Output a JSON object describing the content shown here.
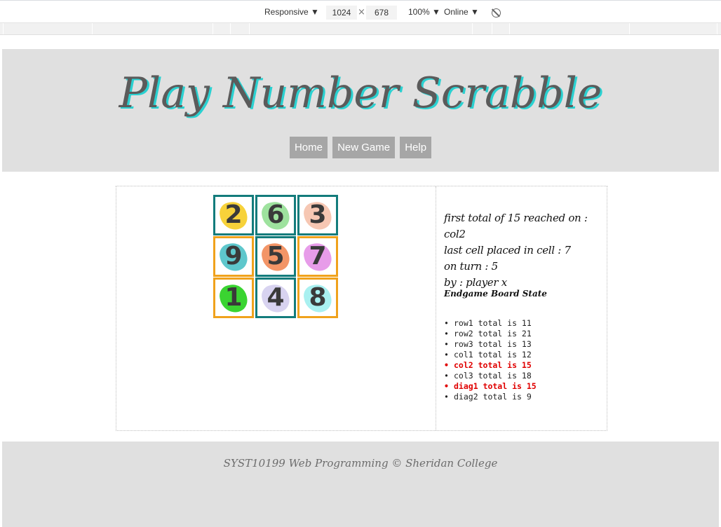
{
  "devtools": {
    "device": "Responsive ▼",
    "width": "1024",
    "times": "×",
    "height": "678",
    "zoom": "100% ▼",
    "network": "Online ▼",
    "rotate_icon": "rotate-icon"
  },
  "header": {
    "title": "Play Number Scrabble",
    "nav": [
      "Home",
      "New Game",
      "Help"
    ]
  },
  "board": {
    "cells": [
      {
        "value": "2",
        "border": "teal",
        "blob": "#f7d23a"
      },
      {
        "value": "6",
        "border": "teal",
        "blob": "#9ee29e"
      },
      {
        "value": "3",
        "border": "teal",
        "blob": "#f6c7b3"
      },
      {
        "value": "9",
        "border": "orange",
        "blob": "#5ec7cc"
      },
      {
        "value": "5",
        "border": "teal",
        "blob": "#f39567"
      },
      {
        "value": "7",
        "border": "orange",
        "blob": "#e79ce9"
      },
      {
        "value": "1",
        "border": "orange",
        "blob": "#3ad431"
      },
      {
        "value": "4",
        "border": "teal",
        "blob": "#d8d3f0"
      },
      {
        "value": "8",
        "border": "orange",
        "blob": "#a9f0f0"
      }
    ]
  },
  "info": {
    "first_total": "first total of 15 reached on : col2",
    "last_cell": "last cell placed in cell : 7",
    "turn": "on turn : 5",
    "by": "by : player x"
  },
  "endgame_heading": "Endgame Board State",
  "totals": [
    {
      "text": "row1 total is 11",
      "highlight": false
    },
    {
      "text": "row2 total is 21",
      "highlight": false
    },
    {
      "text": "row3 total is 13",
      "highlight": false
    },
    {
      "text": "col1 total is 12",
      "highlight": false
    },
    {
      "text": "col2 total is 15",
      "highlight": true
    },
    {
      "text": "col3 total is 18",
      "highlight": false
    },
    {
      "text": "diag1 total is 15",
      "highlight": true
    },
    {
      "text": "diag2 total is 9",
      "highlight": false
    }
  ],
  "colors": {
    "teal": "#137c7c",
    "orange": "#f0a21c",
    "highlight": "#e00000"
  },
  "footer": "SYST10199 Web Programming © Sheridan College"
}
